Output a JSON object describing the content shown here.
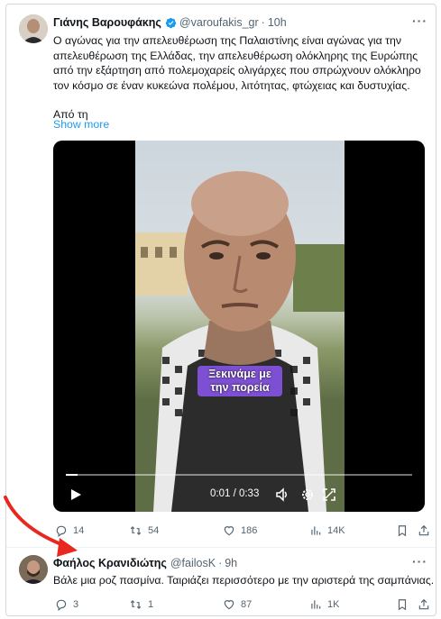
{
  "tweet1": {
    "name": "Γιάνης Βαρουφάκης",
    "handle": "@varoufakis_gr",
    "dot": "·",
    "time": "10h",
    "more": "···",
    "text_lines": [
      "Ο αγώνας για την απελευθέρωση της Παλαιστίνης είναι αγώνας για την",
      "απελευθέρωση της Ελλάδας, την απελευθέρωση ολόκληρης της Ευρώπης",
      "από την εξάρτηση από πολεμοχαρείς ολιγάρχες που σπρώχνουν ολόκληρο",
      "τον κόσμο σε έναν κυκεώνα πολέμου, λιτότητας, φτώχειας και δυστυχίας."
    ],
    "text_tail": "Από τη",
    "show_more": "Show more",
    "video": {
      "caption": "Ξεκινάμε με την πορεία",
      "timecode": "0:01 / 0:33",
      "progress": 0.035
    },
    "actions": {
      "replies": "14",
      "reposts": "54",
      "likes": "186",
      "views": "14K"
    }
  },
  "tweet2": {
    "name": "Φαήλος Κρανιδιώτης",
    "handle": "@failosK",
    "dot": "·",
    "time": "9h",
    "more": "···",
    "text": "Βάλε μια ροζ πασμίνα. Ταιριάζει περισσότερο με την αριστερά της σαμπάνιας.",
    "actions": {
      "replies": "3",
      "reposts": "1",
      "likes": "87",
      "views": "1K"
    }
  },
  "colors": {
    "accent": "#1d9bf0",
    "muted": "#536471",
    "caption_bg": "#7d4fd2",
    "annotation_arrow": "#e8281f"
  }
}
